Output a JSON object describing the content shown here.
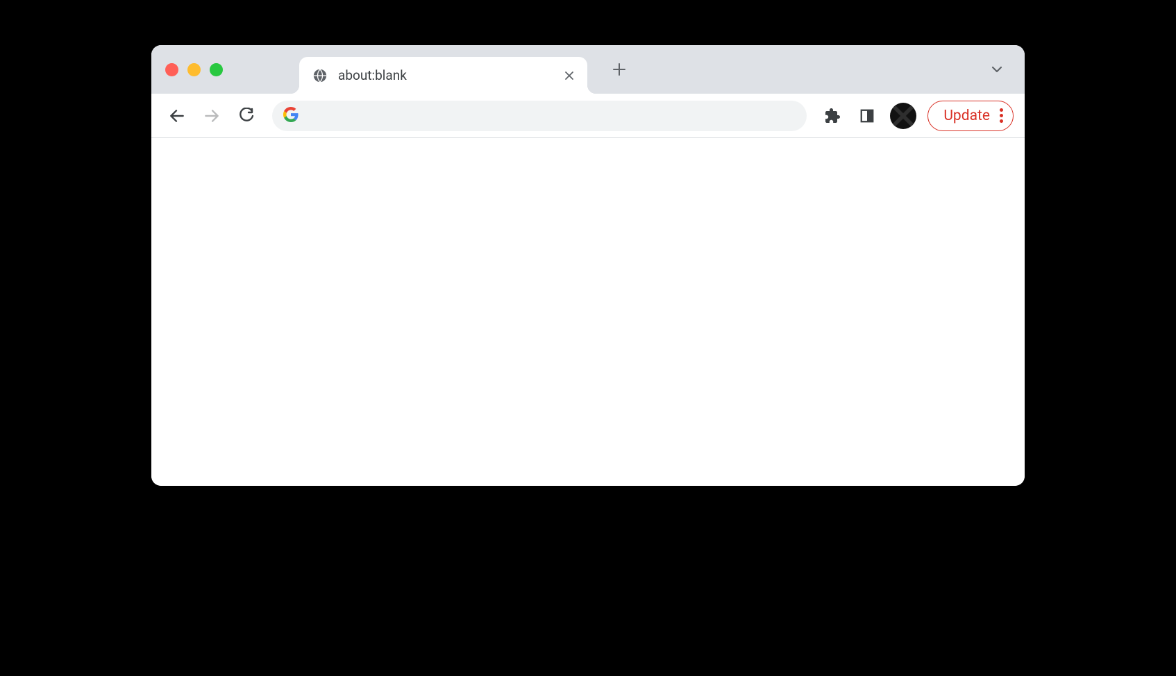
{
  "tab": {
    "title": "about:blank"
  },
  "omnibox": {
    "value": "",
    "placeholder": ""
  },
  "update": {
    "label": "Update"
  }
}
